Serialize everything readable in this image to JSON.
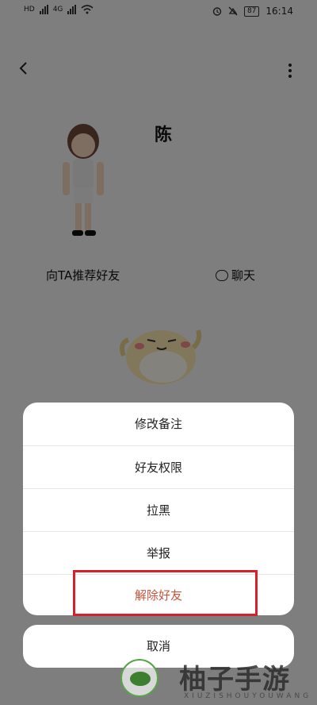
{
  "status_bar": {
    "left_labels": [
      "HD",
      "4G",
      "HD",
      "4G"
    ],
    "battery": "87",
    "time": "16:14"
  },
  "nav": {
    "back_icon": "chevron-left-icon",
    "more_icon": "more-vertical-icon"
  },
  "profile": {
    "name": "陈",
    "recommend_label": "向TA推荐好友",
    "chat_label": "聊天"
  },
  "action_sheet": {
    "items": [
      {
        "label": "修改备注"
      },
      {
        "label": "好友权限"
      },
      {
        "label": "拉黑"
      },
      {
        "label": "举报"
      },
      {
        "label": "解除好友",
        "danger": true
      }
    ],
    "cancel_label": "取消"
  },
  "watermark": {
    "title": "柚子手游网",
    "subtitle": "XIUZISHOUYOUWANG"
  },
  "colors": {
    "overlay": "#000000",
    "danger_text": "#c8553d",
    "highlight_border": "#d8202a",
    "sheet_bg": "#ffffff"
  }
}
